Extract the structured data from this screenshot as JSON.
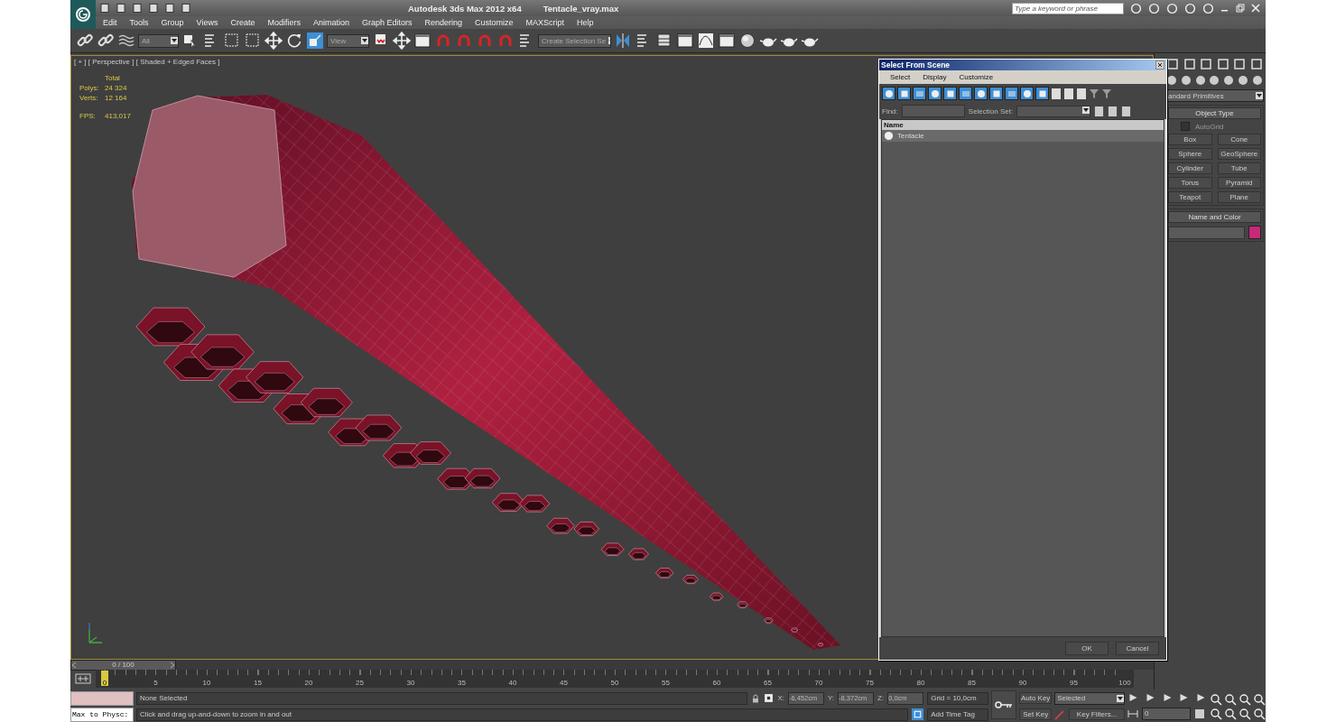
{
  "title_bar": {
    "app_title": "Autodesk 3ds Max  2012 x64",
    "file_name": "Tentacle_vray.max",
    "search_placeholder": "Type a keyword or phrase"
  },
  "menu": [
    "Edit",
    "Tools",
    "Group",
    "Views",
    "Create",
    "Modifiers",
    "Animation",
    "Graph Editors",
    "Rendering",
    "Customize",
    "MAXScript",
    "Help"
  ],
  "toolbar": {
    "selection_filter": "All",
    "reference_coord": "View",
    "named_selection": "Create Selection Se"
  },
  "viewport": {
    "label": "[ + ] [ Perspective ] [ Shaded + Edged Faces ]",
    "stats_heading": "Total",
    "stats": [
      {
        "label": "Polys:",
        "value": "24 324"
      },
      {
        "label": "Verts:",
        "value": "12 164"
      }
    ],
    "fps": {
      "label": "FPS:",
      "value": "413,017"
    }
  },
  "dialog": {
    "title": "Select From Scene",
    "menu": [
      "Select",
      "Display",
      "Customize"
    ],
    "filters": [
      {
        "on": true
      },
      {
        "on": true
      },
      {
        "on": true
      },
      {
        "on": true
      },
      {
        "on": true
      },
      {
        "on": true
      },
      {
        "on": true
      },
      {
        "on": true
      },
      {
        "on": true
      },
      {
        "on": true
      },
      {
        "on": true
      }
    ],
    "find_label": "Find:",
    "selection_set_label": "Selection Set:",
    "column": "Name",
    "rows": [
      {
        "name": "Tentacle",
        "selected": true
      }
    ],
    "buttons": [
      "OK",
      "Cancel"
    ]
  },
  "command_panel": {
    "category": "andard Primitives",
    "object_type_title": "Object Type",
    "autogrid": {
      "label": "AutoGrid",
      "checked": false
    },
    "buttons": [
      "Box",
      "Cone",
      "Sphere",
      "GeoSphere",
      "Cylinder",
      "Tube",
      "Torus",
      "Pyramid",
      "Teapot",
      "Plane"
    ],
    "name_color_title": "Name and Color",
    "color": "#c8287a"
  },
  "timeline": {
    "frame_label": "0 / 100",
    "level": 0,
    "ticks": [
      "0",
      "5",
      "10",
      "15",
      "20",
      "25",
      "30",
      "35",
      "40",
      "45",
      "50",
      "55",
      "60",
      "65",
      "70",
      "75",
      "80",
      "85",
      "90",
      "95",
      "100"
    ]
  },
  "status": {
    "listener": "Max to Physc:",
    "selection": "None Selected",
    "prompt": "Click and drag up-and-down to zoom in and out",
    "coords": [
      {
        "label": "X:",
        "value": "-6,452cm"
      },
      {
        "label": "Y:",
        "value": "-8,372cm"
      },
      {
        "label": "Z:",
        "value": "0,0cm"
      }
    ],
    "grid": "Grid = 10,0cm",
    "time_tag": "Add Time Tag",
    "auto_key": "Auto Key",
    "set_key": "Set Key",
    "key_mode": "Selected",
    "key_filters": "Key Filters...",
    "frame": "0"
  }
}
